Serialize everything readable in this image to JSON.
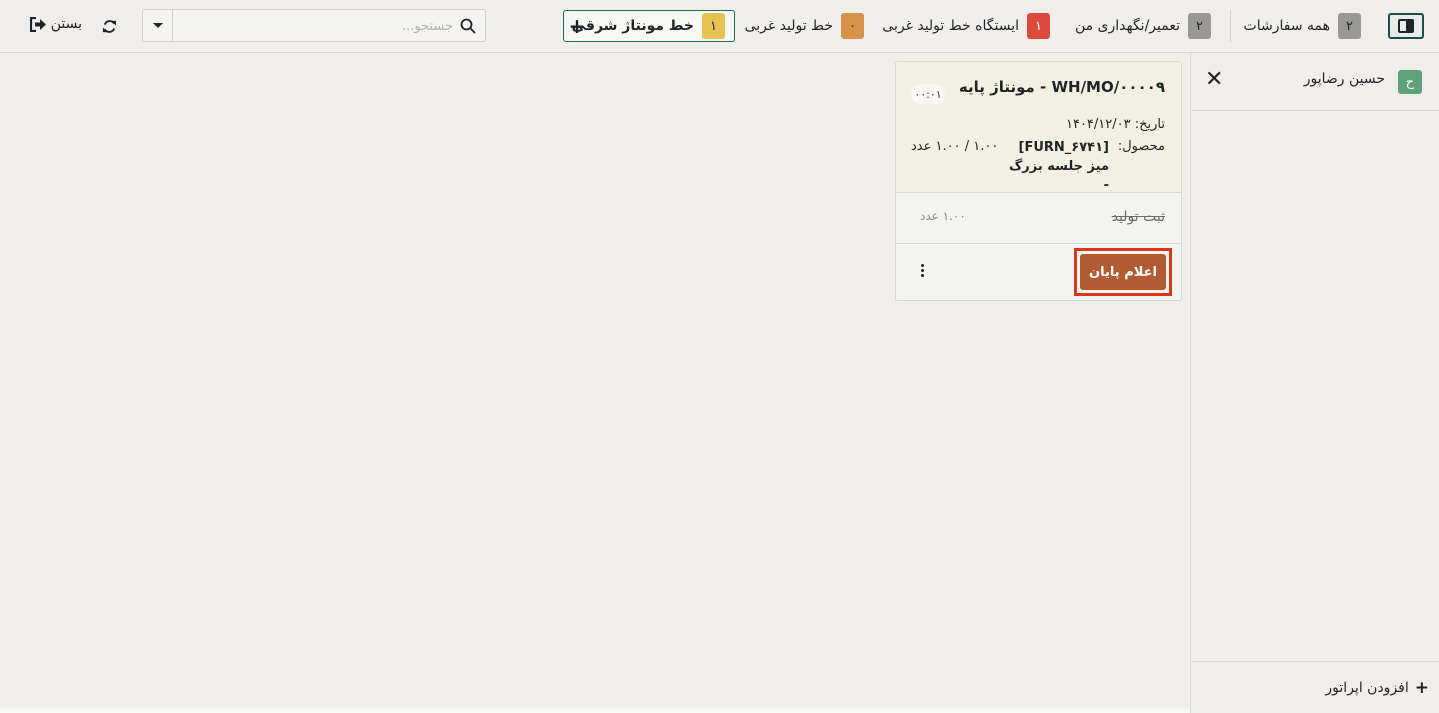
{
  "topbar": {
    "filters": [
      {
        "id": "all",
        "label": "همه سفارشات",
        "count": "۲",
        "badge_color": "#9a9893"
      },
      {
        "id": "repair",
        "label": "تعمیر/نگهداری من",
        "count": "۲",
        "badge_color": "#9a9893"
      },
      {
        "id": "west_station",
        "label": "ایستگاه خط تولید غربی",
        "count": "۱",
        "badge_color": "#dc4a3e"
      },
      {
        "id": "west_line",
        "label": "خط تولید غربی",
        "count": "۰",
        "badge_color": "#d9924a"
      },
      {
        "id": "east_assembly",
        "label": "خط مونتاژ شرقی",
        "count": "۱",
        "badge_color": "#e6c250",
        "active": true
      }
    ],
    "add_icon": "plus-icon",
    "search": {
      "placeholder": "جستجو...",
      "value": "",
      "icon": "search-icon"
    },
    "dropdown_icon": "caret-down-icon",
    "refresh_icon": "refresh-icon",
    "close_label": "بستن",
    "close_icon": "sign-out-icon",
    "panel_toggle_icon": "panel-icon"
  },
  "sidebar": {
    "operator": {
      "initial": "ح",
      "name": "حسین رضاپور",
      "avatar_color": "#5fa27a"
    },
    "add_operator_label": "افزودن اپراتور"
  },
  "card": {
    "title": "WH/MO/۰۰۰۰۹ - مونتاژ پایه",
    "timer": "۰۰:۰۱",
    "date_label": "تاریخ:",
    "date_value": "۱۴۰۴/۱۲/۰۳",
    "product_label": "محصول:",
    "product_name": "[FURN_۶۷۴۱] میز جلسه بزرگ -",
    "product_qty": "۱.۰۰ / ۱.۰۰ عدد",
    "step_name": "ثبت تولید",
    "step_qty": "۱.۰۰ عدد",
    "done_label": "اعلام پایان",
    "done_color": "#b05b32",
    "highlight_color": "#d63a1c"
  }
}
